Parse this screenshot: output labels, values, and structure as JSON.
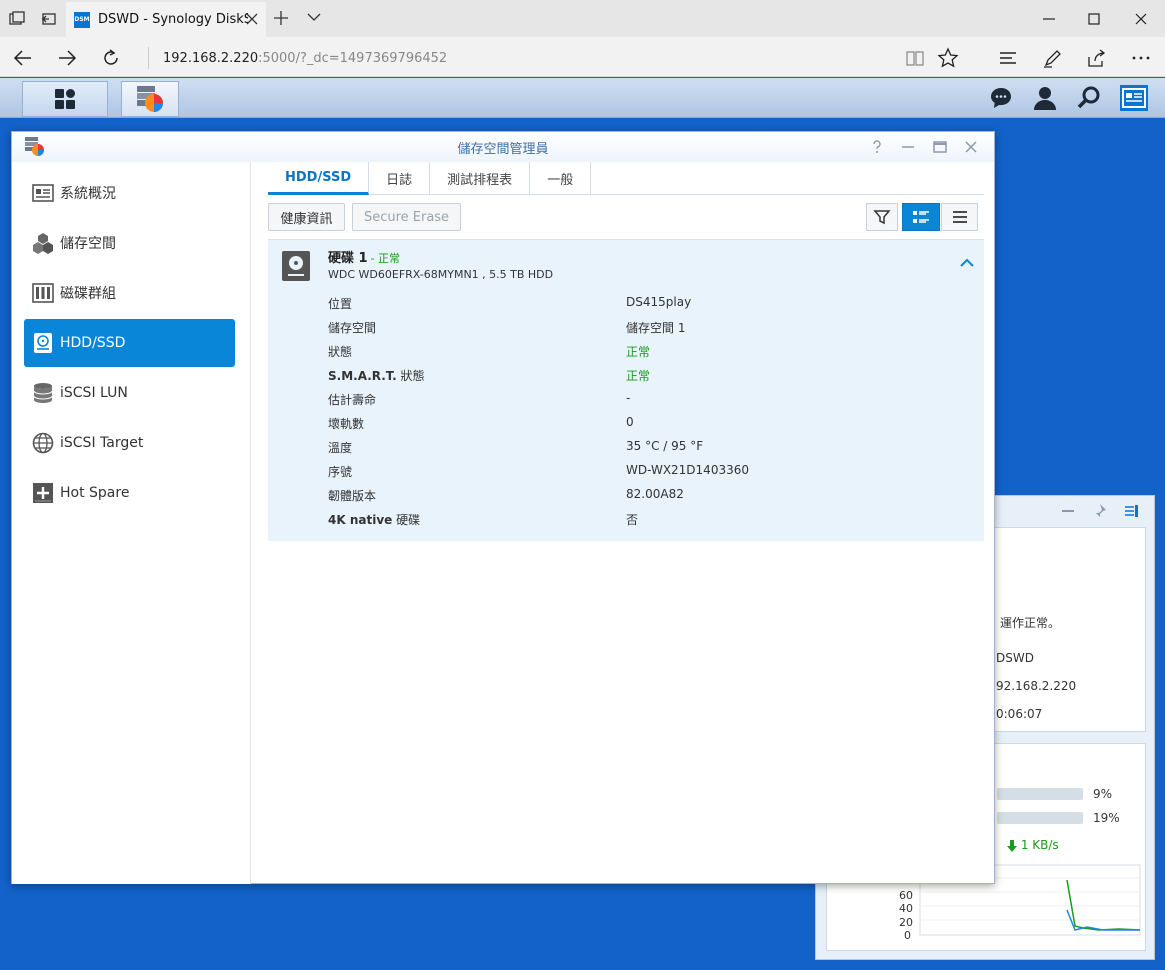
{
  "browser": {
    "tab_title": "DSWD - Synology DiskS",
    "favicon_text": "DSM",
    "url_host": "192.168.2.220",
    "url_path": ":5000/?_dc=1497369796452"
  },
  "window": {
    "title": "儲存空間管理員"
  },
  "sidebar": {
    "items": [
      {
        "label": "系統概況",
        "icon": "overview-icon"
      },
      {
        "label": "儲存空間",
        "icon": "cubes-icon"
      },
      {
        "label": "磁碟群組",
        "icon": "raid-group-icon"
      },
      {
        "label": "HDD/SSD",
        "icon": "hdd-icon",
        "active": true
      },
      {
        "label": "iSCSI LUN",
        "icon": "database-icon"
      },
      {
        "label": "iSCSI Target",
        "icon": "globe-icon"
      },
      {
        "label": "Hot Spare",
        "icon": "plus-box-icon"
      }
    ]
  },
  "tabs": [
    "HDD/SSD",
    "日誌",
    "測試排程表",
    "一般"
  ],
  "toolbar": {
    "health_info": "健康資訊",
    "secure_erase": "Secure Erase"
  },
  "disk": {
    "name": "硬碟 1",
    "status": "- 正常",
    "model": "WDC WD60EFRX-68MYMN1 , 5.5 TB HDD",
    "properties": [
      {
        "key": "位置",
        "value": "DS415play"
      },
      {
        "key": "儲存空間",
        "value": "儲存空間 1"
      },
      {
        "key": "狀態",
        "value": "正常",
        "ok": true
      },
      {
        "key": "S.M.A.R.T. 狀態",
        "value": "正常",
        "ok": true,
        "bold_prefix": "S.M.A.R.T.",
        "rest": " 狀態"
      },
      {
        "key": "估計壽命",
        "value": "-"
      },
      {
        "key": "壞軌數",
        "value": "0"
      },
      {
        "key": "溫度",
        "value": "35 °C / 95 °F"
      },
      {
        "key": "序號",
        "value": "WD-WX21D1403360"
      },
      {
        "key": "韌體版本",
        "value": "82.00A82"
      },
      {
        "key": "4K native 硬碟",
        "value": "否",
        "bold_prefix": "4K native",
        "rest": " 硬碟"
      }
    ]
  },
  "widget": {
    "status_text": "運作正常。",
    "server_name": "DSWD",
    "ip": "92.168.2.220",
    "uptime": "0:06:07",
    "cpu_percent": 9,
    "ram_percent": 19,
    "cpu_label": "9%",
    "ram_label": "19%",
    "net_down": "1 KB/s",
    "chart_ticks": [
      "60",
      "40",
      "20",
      "0"
    ]
  }
}
